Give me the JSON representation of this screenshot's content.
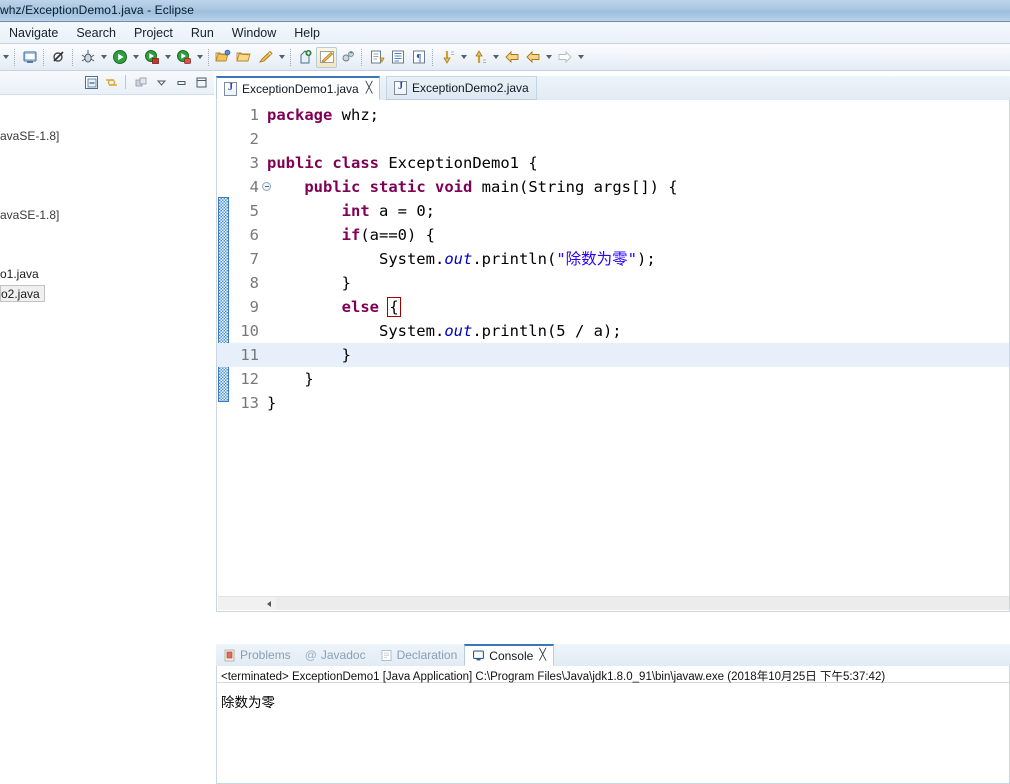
{
  "window": {
    "title": "whz/ExceptionDemo1.java - Eclipse"
  },
  "menubar": {
    "items": [
      {
        "label": "Navigate"
      },
      {
        "label": "Search"
      },
      {
        "label": "Project"
      },
      {
        "label": "Run"
      },
      {
        "label": "Window"
      },
      {
        "label": "Help"
      }
    ]
  },
  "toolbar": {
    "groups": [
      {
        "buttons": [
          {
            "icon": "dropdown-arrow-icon",
            "label": ""
          },
          {
            "icon": "new-wizard-icon",
            "label": "New"
          },
          {
            "icon": "skip-breakpoints-icon",
            "label": "Skip All Breakpoints"
          },
          {
            "icon": "debug-icon",
            "label": "Debug"
          },
          {
            "icon": "dropdown-arrow-icon",
            "label": ""
          },
          {
            "icon": "run-icon",
            "label": "Run"
          },
          {
            "icon": "dropdown-arrow-icon",
            "label": ""
          },
          {
            "icon": "coverage-icon",
            "label": "Coverage As"
          },
          {
            "icon": "dropdown-arrow-icon",
            "label": ""
          },
          {
            "icon": "external-tools-icon",
            "label": "External Tools"
          },
          {
            "icon": "dropdown-arrow-icon",
            "label": ""
          },
          {
            "icon": "open-type-icon",
            "label": "Open Type"
          },
          {
            "icon": "open-task-icon",
            "label": "Open Task"
          },
          {
            "icon": "search-icon",
            "label": "Search"
          },
          {
            "icon": "dropdown-arrow-icon",
            "label": ""
          },
          {
            "icon": "new-java-package-icon",
            "label": "New Java Package"
          },
          {
            "icon": "toggle-mark-occurrences-icon",
            "label": "Toggle Mark Occurrences"
          },
          {
            "icon": "link-editor-icon",
            "label": "Link with Editor"
          },
          {
            "icon": "next-annotation-icon",
            "label": "Next Annotation"
          },
          {
            "icon": "show-whitespace-icon",
            "label": "Show Whitespace Characters"
          },
          {
            "icon": "pilcrow-icon",
            "label": "Show Print Margin"
          },
          {
            "icon": "next-edit-icon",
            "label": "Next Edit Location"
          },
          {
            "icon": "dropdown-arrow-icon",
            "label": ""
          },
          {
            "icon": "previous-edit-icon",
            "label": "Previous Edit Location"
          },
          {
            "icon": "dropdown-arrow-icon",
            "label": ""
          },
          {
            "icon": "back-icon",
            "label": "Back"
          },
          {
            "icon": "back-history-icon",
            "label": "Back History"
          },
          {
            "icon": "dropdown-arrow-icon",
            "label": ""
          },
          {
            "icon": "forward-icon",
            "label": "Forward"
          },
          {
            "icon": "dropdown-arrow-icon",
            "label": ""
          }
        ]
      }
    ]
  },
  "package_explorer": {
    "toolbar": [
      {
        "icon": "collapse-all-icon",
        "label": "Collapse All"
      },
      {
        "icon": "link-with-editor-icon",
        "label": "Link with Editor"
      },
      {
        "icon": "view-menu-icon",
        "label": "View Menu"
      },
      {
        "icon": "minimize-icon",
        "label": "Minimize"
      },
      {
        "icon": "maximize-icon",
        "label": "Maximize"
      }
    ],
    "items": [
      {
        "label": "avaSE-1.8]"
      },
      {
        "label": "avaSE-1.8]"
      },
      {
        "label": "o1.java",
        "selected": false
      },
      {
        "label": "o2.java",
        "selected": true
      }
    ]
  },
  "editor": {
    "tabs": [
      {
        "label": "ExceptionDemo1.java",
        "active": true,
        "close": "╳"
      },
      {
        "label": "ExceptionDemo2.java",
        "active": false,
        "close": ""
      }
    ],
    "lines": [
      {
        "num": "1",
        "folding": false,
        "highlight": false
      },
      {
        "num": "2",
        "folding": false,
        "highlight": false
      },
      {
        "num": "3",
        "folding": false,
        "highlight": false
      },
      {
        "num": "4",
        "folding": true,
        "highlight": false
      },
      {
        "num": "5",
        "folding": false,
        "highlight": false
      },
      {
        "num": "6",
        "folding": false,
        "highlight": false
      },
      {
        "num": "7",
        "folding": false,
        "highlight": false
      },
      {
        "num": "8",
        "folding": false,
        "highlight": false
      },
      {
        "num": "9",
        "folding": false,
        "highlight": false
      },
      {
        "num": "10",
        "folding": false,
        "highlight": false
      },
      {
        "num": "11",
        "folding": false,
        "highlight": true
      },
      {
        "num": "12",
        "folding": false,
        "highlight": false
      },
      {
        "num": "13",
        "folding": false,
        "highlight": false
      }
    ],
    "source_text": [
      "package whz;",
      "",
      "public class ExceptionDemo1 {",
      "    public static void main(String args[]) {",
      "        int a = 0;",
      "        if(a==0) {",
      "            System.out.println(\"除数为零\");",
      "        }",
      "        else {",
      "            System.out.println(5 / a);",
      "        }",
      "    }",
      "}"
    ],
    "tokens": {
      "l1": {
        "kw": "package",
        "rest": " whz;"
      },
      "l3": {
        "kw1": "public",
        "kw2": "class",
        "name": " ExceptionDemo1 {"
      },
      "l4": {
        "kw1": "public",
        "kw2": "static",
        "kw3": "void",
        "rest": " main(String args[]) {"
      },
      "l5": {
        "kw": "int",
        "rest": " a = 0;"
      },
      "l6": {
        "kw": "if",
        "rest": "(a==0) {"
      },
      "l7": {
        "cls": "System",
        "fld": "out",
        "call": ".println(",
        "str": "\"除数为零\"",
        "end": ");"
      },
      "l8": {
        "rest": "}"
      },
      "l9": {
        "kw": "else",
        "brace": "{"
      },
      "l10": {
        "cls": "System",
        "fld": "out",
        "call": ".println(5 / a);"
      },
      "l11": {
        "rest": "}"
      },
      "l12": {
        "rest": "}"
      },
      "l13": {
        "rest": "}"
      }
    }
  },
  "bottom_tabs": [
    {
      "label": "Problems",
      "icon": "problems-icon",
      "active": false
    },
    {
      "label": "Javadoc",
      "icon": "javadoc-icon",
      "active": false
    },
    {
      "label": "Declaration",
      "icon": "declaration-icon",
      "active": false
    },
    {
      "label": "Console",
      "icon": "console-icon",
      "active": true,
      "close": "╳"
    }
  ],
  "console": {
    "status_line": "<terminated> ExceptionDemo1 [Java Application] C:\\Program Files\\Java\\jdk1.8.0_91\\bin\\javaw.exe (2018年10月25日 下午5:37:42)",
    "output": "除数为零"
  },
  "colors": {
    "titlebar": "#a8c6e2",
    "keyword": "#7f0055",
    "string": "#2a00ff",
    "field": "#0000c0",
    "line_number": "#787878",
    "current_line": "#e7f0fa",
    "change_bar": "#4a90d9",
    "tab_active_top": "#3a77b8"
  }
}
